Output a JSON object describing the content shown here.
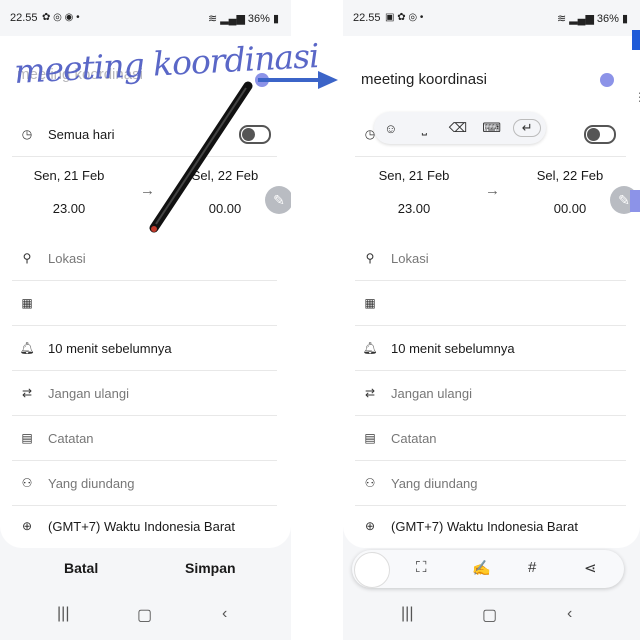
{
  "left": {
    "status": {
      "time": "22.55",
      "battery": "36%"
    },
    "title_placeholder": "meeting koordinasi",
    "handwriting_text": "meeting koordinasi",
    "all_day_label": "Semua hari",
    "start": {
      "date": "Sen, 21 Feb",
      "time": "23.00"
    },
    "end": {
      "date": "Sel, 22 Feb",
      "time": "00.00"
    },
    "location": "Lokasi",
    "reminder": "10 menit sebelumnya",
    "repeat": "Jangan ulangi",
    "notes": "Catatan",
    "invitees": "Yang diundang",
    "timezone": "(GMT+7) Waktu Indonesia Barat",
    "cancel": "Batal",
    "save": "Simpan"
  },
  "right": {
    "status": {
      "time": "22.55",
      "battery": "36%"
    },
    "title": "meeting koordinasi",
    "start": {
      "date": "Sen, 21 Feb",
      "time": "23.00"
    },
    "end": {
      "date": "Sel, 22 Feb",
      "time": "00.00"
    },
    "location": "Lokasi",
    "reminder": "10 menit sebelumnya",
    "repeat": "Jangan ulangi",
    "notes": "Catatan",
    "invitees": "Yang diundang",
    "timezone": "(GMT+7) Waktu Indonesia Barat"
  },
  "colors": {
    "event_color": "#8c93e8",
    "arrow": "#3b64c8",
    "handwriting": "#5a67c7"
  }
}
